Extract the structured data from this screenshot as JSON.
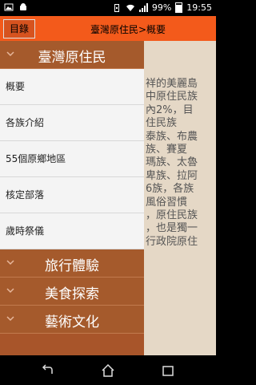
{
  "status_bar": {
    "battery": "99%",
    "time": "19:55"
  },
  "app_bar": {
    "menu_button_label": "目錄",
    "title": "臺灣原住民>概要"
  },
  "drawer": {
    "categories": [
      {
        "label": "臺灣原住民",
        "expanded": true,
        "items": [
          "概要",
          "各族介紹",
          "55個原鄉地區",
          "核定部落",
          "歲時祭儀"
        ]
      },
      {
        "label": "旅行體驗",
        "expanded": false
      },
      {
        "label": "美食探索",
        "expanded": false
      },
      {
        "label": "藝術文化",
        "expanded": false
      }
    ]
  },
  "content": {
    "visible_text": "祥的美麗島\n中原住民族\n內2%，目\n住民族\n泰族、布農\n族、賽夏\n瑪族、太魯\n卑族、拉阿\n6族，各族\n風俗習慣\n，原住民族\n，也是獨一\n行政院原住"
  },
  "colors": {
    "accent": "#f35a1b",
    "drawer_category_bg": "#a55a2c",
    "content_bg": "#e5d8c6"
  }
}
